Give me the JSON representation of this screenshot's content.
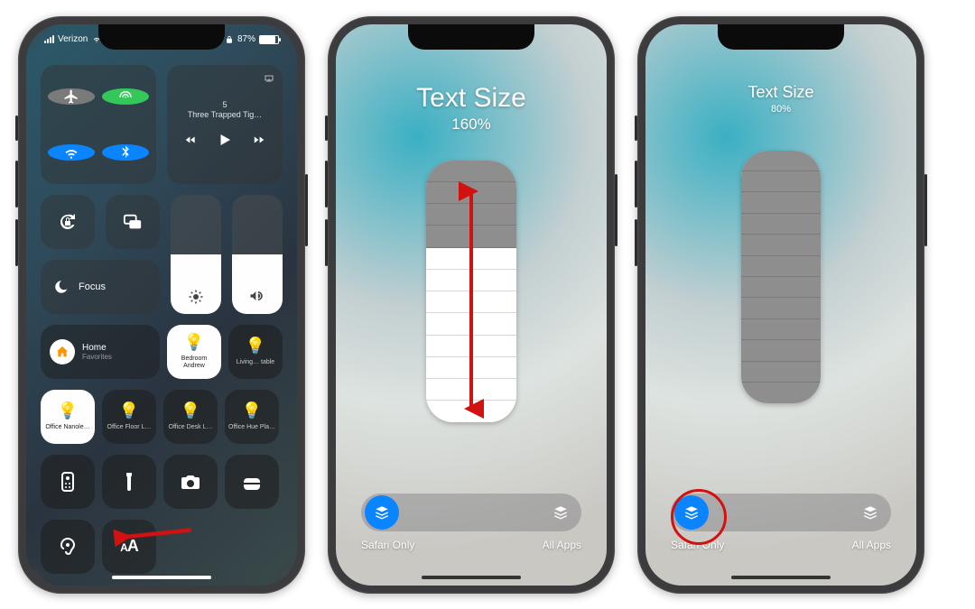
{
  "status": {
    "carrier": "Verizon",
    "battery_pct": "87%"
  },
  "media": {
    "line1": "5",
    "line2": "Three Trapped Tig…"
  },
  "focus_label": "Focus",
  "home_tile": {
    "title": "Home",
    "subtitle": "Favorites"
  },
  "accessories": {
    "bedroom": "Bedroom Andrew",
    "living": "Living… table",
    "office_nano": "Office Nanole…",
    "office_floor": "Office Floor L…",
    "office_desk": "Office Desk L…",
    "office_hue": "Office Hue Pla…"
  },
  "text_size": {
    "title": "Text Size",
    "pct_160": "160%",
    "pct_80": "80%",
    "scope_left": "Safari Only",
    "scope_right": "All Apps"
  }
}
